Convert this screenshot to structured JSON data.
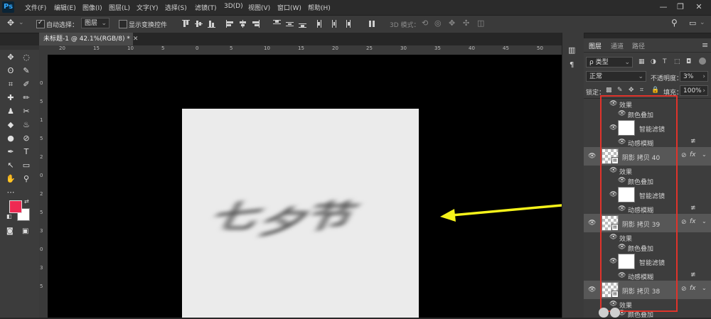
{
  "app": {
    "logo": "Ps"
  },
  "menu": [
    "文件(F)",
    "编辑(E)",
    "图像(I)",
    "图层(L)",
    "文字(Y)",
    "选择(S)",
    "滤镜(T)",
    "3D(D)",
    "视图(V)",
    "窗口(W)",
    "帮助(H)"
  ],
  "window_controls": {
    "minimize": "—",
    "restore": "❐",
    "close": "✕"
  },
  "options": {
    "move_glyph": "✥",
    "auto_select_label": "自动选择：",
    "auto_select_checked": true,
    "target": "图层",
    "show_transform_label": "显示变换控件",
    "show_transform_checked": false,
    "mode3d_label": "3D 模式："
  },
  "document": {
    "tab_title": "未标题-1 @ 42.1%(RGB/8) *"
  },
  "ruler": {
    "top": [
      "20",
      "15",
      "10",
      "5",
      "0",
      "5",
      "10",
      "15",
      "20",
      "25",
      "30",
      "35",
      "40",
      "45",
      "50"
    ],
    "left": [
      "0",
      "5",
      "1",
      "5",
      "2",
      "0",
      "2",
      "5",
      "3",
      "0",
      "3",
      "5"
    ]
  },
  "canvas": {
    "text": "七夕节"
  },
  "tools": [
    [
      "✥",
      "◌"
    ],
    [
      "ʘ",
      "✎"
    ],
    [
      "⌗",
      "✐"
    ],
    [
      "✚",
      "✏"
    ],
    [
      "♟",
      "✂"
    ],
    [
      "◆",
      "♨"
    ],
    [
      "●",
      "⊘"
    ],
    [
      "✒",
      "T"
    ],
    [
      "↖",
      "▭"
    ],
    [
      "✋",
      "⚲"
    ],
    [
      "⋯",
      ""
    ]
  ],
  "colors": {
    "foreground": "#ee2a52",
    "background": "#ffffff",
    "highlight": "#e0332b",
    "arrow": "#f5f21a"
  },
  "panel": {
    "tabs": [
      "图层",
      "通道",
      "路径"
    ],
    "filter_kind": "ρ 类型",
    "blend_mode": "正常",
    "opacity_label": "不透明度：",
    "opacity_value": "3%",
    "lock_label": "锁定：",
    "fill_label": "填充：",
    "fill_value": "100%",
    "effects_label": "效果",
    "color_overlay": "颜色叠加",
    "smart_filters": "智能滤镜",
    "motion_blur": "动感模糊",
    "layers": [
      {
        "name": "阴影 拷贝 40"
      },
      {
        "name": "阴影 拷贝 39"
      },
      {
        "name": "阴影 拷贝 38"
      }
    ],
    "fx": "fx"
  }
}
